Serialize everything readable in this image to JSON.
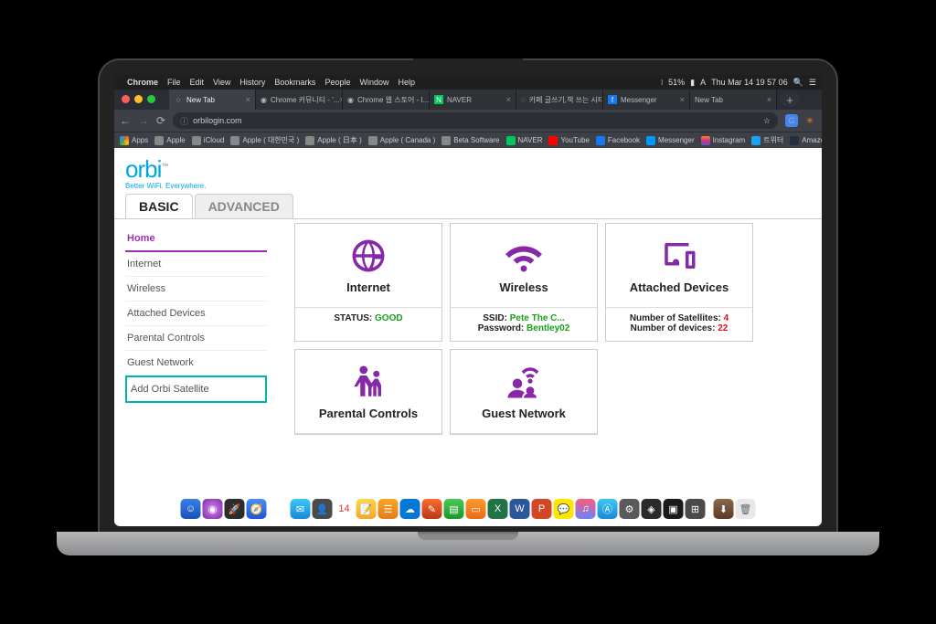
{
  "menubar": {
    "app": "Chrome",
    "items": [
      "File",
      "Edit",
      "View",
      "History",
      "Bookmarks",
      "People",
      "Window",
      "Help"
    ],
    "battery": "51%",
    "datetime": "Thu Mar 14 19 57 06"
  },
  "browser_tabs": [
    {
      "label": "New Tab",
      "active": true
    },
    {
      "label": "Chrome 커뮤니티 - '...",
      "active": false
    },
    {
      "label": "Chrome 웹 스토어 - I...",
      "active": false
    },
    {
      "label": "NAVER",
      "active": false
    },
    {
      "label": "카페 글쓰기,책 쓰는 시티...",
      "active": false
    },
    {
      "label": "Messenger",
      "active": false
    },
    {
      "label": "New Tab",
      "active": false
    }
  ],
  "url": "orbilogin.com",
  "bookmarks": [
    {
      "label": "Apps",
      "color": "#4285f4"
    },
    {
      "label": "Apple",
      "color": "#888"
    },
    {
      "label": "iCloud",
      "color": "#888"
    },
    {
      "label": "Apple ( 대한민국 )",
      "color": "#888"
    },
    {
      "label": "Apple ( 日本 )",
      "color": "#888"
    },
    {
      "label": "Apple ( Canada )",
      "color": "#888"
    },
    {
      "label": "Beta Software",
      "color": "#888"
    },
    {
      "label": "NAVER",
      "color": "#03c75a"
    },
    {
      "label": "YouTube",
      "color": "#ff0000"
    },
    {
      "label": "Facebook",
      "color": "#1877f2"
    },
    {
      "label": "Messenger",
      "color": "#0099ff"
    },
    {
      "label": "Instagram",
      "color": "#e1306c"
    },
    {
      "label": "트위터",
      "color": "#1da1f2"
    },
    {
      "label": "Amazon",
      "color": "#ff9900"
    }
  ],
  "orbi": {
    "logo": "orbi",
    "tagline": "Better WiFi. Everywhere.",
    "tabs": {
      "basic": "BASIC",
      "advanced": "ADVANCED"
    },
    "sidebar": [
      "Home",
      "Internet",
      "Wireless",
      "Attached Devices",
      "Parental Controls",
      "Guest Network",
      "Add Orbi Satellite"
    ],
    "cards": {
      "internet": {
        "title": "Internet",
        "status_label": "STATUS:",
        "status_value": "GOOD"
      },
      "wireless": {
        "title": "Wireless",
        "ssid_label": "SSID:",
        "ssid_value": "Pete The C...",
        "pwd_label": "Password:",
        "pwd_value": "Bentley02"
      },
      "attached": {
        "title": "Attached Devices",
        "sat_label": "Number of Satellites:",
        "sat_value": "4",
        "dev_label": "Number of devices:",
        "dev_value": "22"
      },
      "parental": {
        "title": "Parental Controls"
      },
      "guest": {
        "title": "Guest Network"
      }
    }
  }
}
